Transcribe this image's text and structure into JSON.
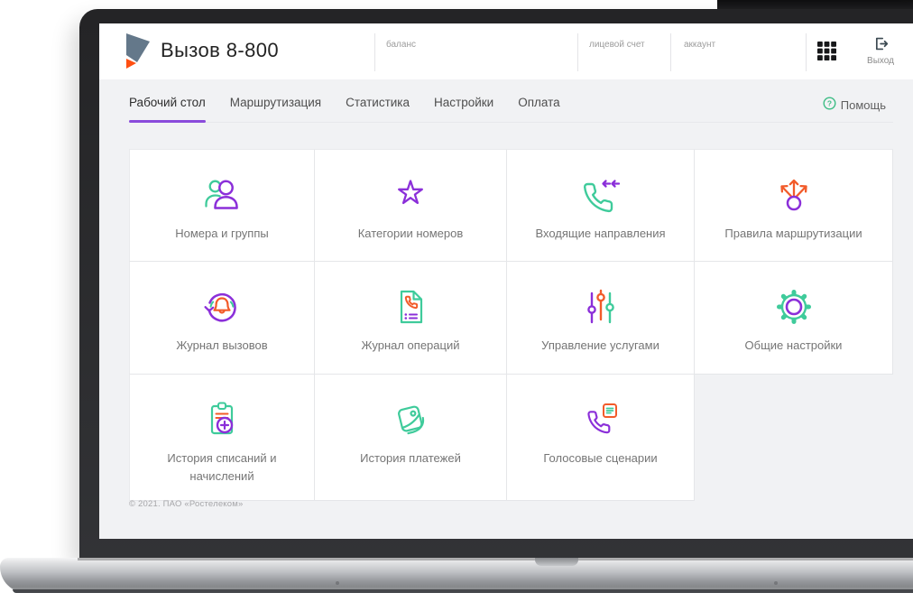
{
  "brand": {
    "title": "Вызов 8-800"
  },
  "header": {
    "account_fields": [
      {
        "id": "balance",
        "label": "баланс"
      },
      {
        "id": "personal-account",
        "label": "лицевой счет"
      },
      {
        "id": "account",
        "label": "аккаунт"
      }
    ],
    "logout_label": "Выход"
  },
  "nav": {
    "tabs": [
      {
        "id": "desktop",
        "label": "Рабочий стол",
        "active": true
      },
      {
        "id": "routing",
        "label": "Маршрутизация",
        "active": false
      },
      {
        "id": "statistics",
        "label": "Статистика",
        "active": false
      },
      {
        "id": "settings",
        "label": "Настройки",
        "active": false
      },
      {
        "id": "payment",
        "label": "Оплата",
        "active": false
      }
    ],
    "help_label": "Помощь"
  },
  "tiles": [
    {
      "id": "numbers-groups",
      "label": "Номера и группы",
      "icon": "users-icon"
    },
    {
      "id": "number-categories",
      "label": "Категории номеров",
      "icon": "star-icon"
    },
    {
      "id": "incoming-directions",
      "label": "Входящие направления",
      "icon": "incoming-call-icon"
    },
    {
      "id": "routing-rules",
      "label": "Правила маршрутизации",
      "icon": "routing-icon"
    },
    {
      "id": "call-log",
      "label": "Журнал вызовов",
      "icon": "call-log-icon"
    },
    {
      "id": "operations-log",
      "label": "Журнал операций",
      "icon": "operations-log-icon"
    },
    {
      "id": "service-management",
      "label": "Управление услугами",
      "icon": "sliders-icon"
    },
    {
      "id": "general-settings",
      "label": "Общие настройки",
      "icon": "gear-icon"
    },
    {
      "id": "charges-history",
      "label": "История списаний и начислений",
      "icon": "clipboard-plus-icon"
    },
    {
      "id": "payments-history",
      "label": "История платежей",
      "icon": "wallet-icon"
    },
    {
      "id": "voice-scenarios",
      "label": "Голосовые сценарии",
      "icon": "voice-script-icon"
    }
  ],
  "footer": {
    "copyright": "© 2021. ПАО «Ростелеком»"
  },
  "colors": {
    "green": "#3fcb9b",
    "purple": "#8b2fd9",
    "orange": "#f25b2a",
    "tab_underline": "#8a4bdb",
    "help_green": "#3dbd85",
    "logo_slate": "#64788a",
    "logo_orange": "#ff4f12",
    "page_bg": "#f1f2f4"
  }
}
